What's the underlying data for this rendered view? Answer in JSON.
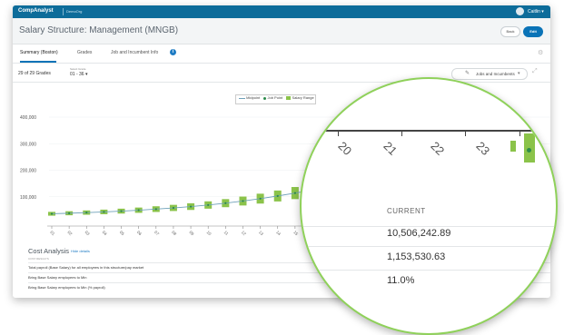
{
  "app": {
    "brand": "CompAnalyst",
    "company": "DemoOrg",
    "user": "Caitlin"
  },
  "page": {
    "title": "Salary Structure: Management (MNGB)",
    "back_label": "Back",
    "edit_label": "Edit"
  },
  "tabs": [
    {
      "label": "Summary (Boston)"
    },
    {
      "label": "Grades"
    },
    {
      "label": "Job and Incumbent Info"
    }
  ],
  "filter": {
    "grades_count": "29 of 29 Grades",
    "grade_select_label": "Select Grade",
    "grade_select_value": "01 - 36",
    "jobs_button_label": "Jobs and Incumbents"
  },
  "legend": {
    "midpoint": "Midpoint",
    "jobpoint": "Job Point",
    "range": "Salary Range"
  },
  "chart_data": {
    "type": "line",
    "series": [
      {
        "name": "Midpoint",
        "values": [
          36000,
          38000,
          40500,
          43000,
          46000,
          49500,
          53500,
          58000,
          63000,
          69000,
          76000,
          84000,
          93000,
          103000,
          114000,
          126000
        ]
      }
    ],
    "yticks": [
      100000,
      200000,
      300000,
      400000
    ],
    "ytick_labels": [
      "100,000",
      "200,000",
      "300,000",
      "400,000"
    ],
    "xtick_labels": [
      "01",
      "02",
      "03",
      "04",
      "05",
      "06",
      "07",
      "08",
      "09",
      "10",
      "11",
      "12",
      "13",
      "14",
      "15",
      "16"
    ],
    "range_pct": 0.2,
    "ylim": [
      0,
      480000
    ],
    "colors": {
      "range": "#8bc34a",
      "midpoint": "#6fa1b9",
      "jobpoint": "#2b8a4a"
    }
  },
  "cost": {
    "title": "Cost Analysis",
    "hide_label": "Hide details",
    "subtitle": "COST RESULTS",
    "rows": [
      {
        "label": "Total payroll (Base Salary) for all employees in this structure/pay market"
      },
      {
        "label": "Bring Base Salary employees to Min"
      },
      {
        "label": "Bring Base Salary employees to Min (% payroll)"
      }
    ]
  },
  "zoom": {
    "x_labels": [
      "20",
      "21",
      "22",
      "23"
    ],
    "current_label": "CURRENT",
    "values": [
      "10,506,242.89",
      "1,153,530.63",
      "11.0%"
    ]
  }
}
